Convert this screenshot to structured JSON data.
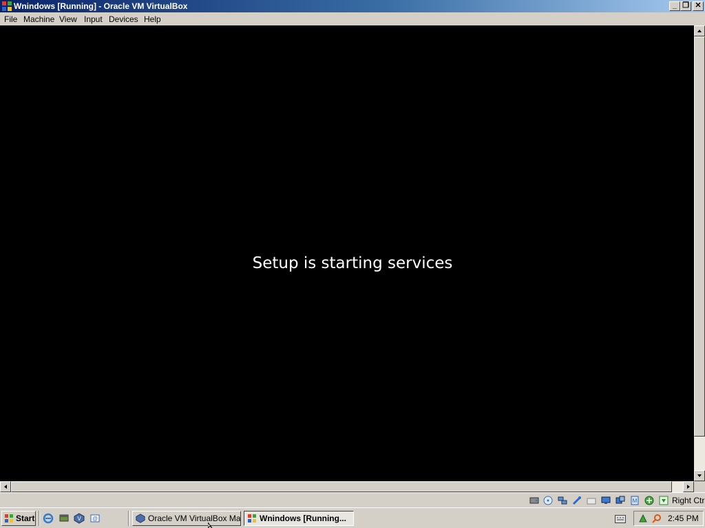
{
  "window": {
    "title": "Wnindows  [Running] - Oracle VM VirtualBox",
    "controls": {
      "minimize": "_",
      "maximize": "❐",
      "close": "✕"
    }
  },
  "menu": [
    "File",
    "Machine",
    "View",
    "Input",
    "Devices",
    "Help"
  ],
  "vm": {
    "message": "Setup is starting services",
    "background": "#000000"
  },
  "statusbar": {
    "icons": [
      "hard-disk-icon",
      "optical-drive-icon",
      "network-icon",
      "usb-icon",
      "shared-folders-icon",
      "display-icon",
      "video-capture-icon",
      "mouse-integration-icon",
      "virtualization-icon",
      "arrow-down-icon"
    ],
    "host_key": "Right Ctrl"
  },
  "taskbar": {
    "start_label": "Start",
    "quick_launch": [
      "internet-explorer-icon",
      "show-desktop-icon",
      "virtualbox-icon",
      "outlook-express-icon"
    ],
    "tasks": [
      {
        "label": "Oracle VM VirtualBox Ma...",
        "icon": "virtualbox-icon",
        "active": false
      },
      {
        "label": "Wnindows  [Running...",
        "icon": "vm-window-icon",
        "active": true
      }
    ],
    "clock": "2:45 PM"
  },
  "colors": {
    "titlebar_start": "#0a246a",
    "titlebar_end": "#a6caf0",
    "chrome": "#d4d0c8"
  }
}
